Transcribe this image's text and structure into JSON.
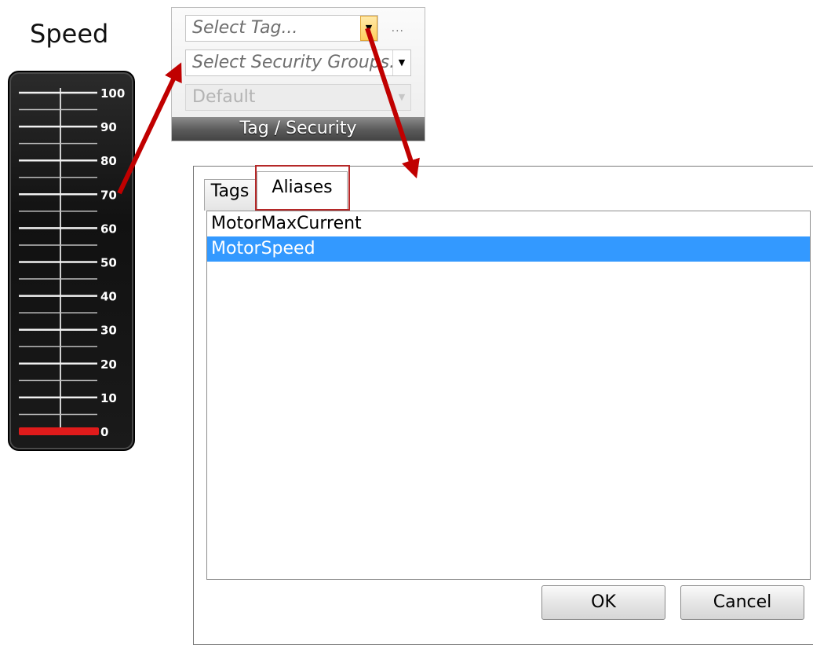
{
  "gauge": {
    "title": "Speed",
    "ticks": [
      "100",
      "90",
      "80",
      "70",
      "60",
      "50",
      "40",
      "30",
      "20",
      "10",
      "0"
    ],
    "value": 0,
    "bar_color": "#e01b1b"
  },
  "tag_panel": {
    "tag_placeholder": "Select Tag...",
    "security_placeholder": "Select Security Groups...",
    "default_value": "Default",
    "ellipsis": "...",
    "footer_label": "Tag / Security"
  },
  "dialog": {
    "tabs": [
      {
        "label": "Tags",
        "selected": false
      },
      {
        "label": "Aliases",
        "selected": true
      }
    ],
    "list_items": [
      {
        "label": "MotorMaxCurrent",
        "selected": false
      },
      {
        "label": "MotorSpeed",
        "selected": true
      }
    ],
    "ok_label": "OK",
    "cancel_label": "Cancel"
  },
  "colors": {
    "selection": "#3399ff",
    "highlight_frame": "#b52828",
    "callout_arrow": "#c00000"
  },
  "icons": {
    "dropdown_arrow": "chevron-down-icon",
    "callout": "arrow-icon"
  }
}
